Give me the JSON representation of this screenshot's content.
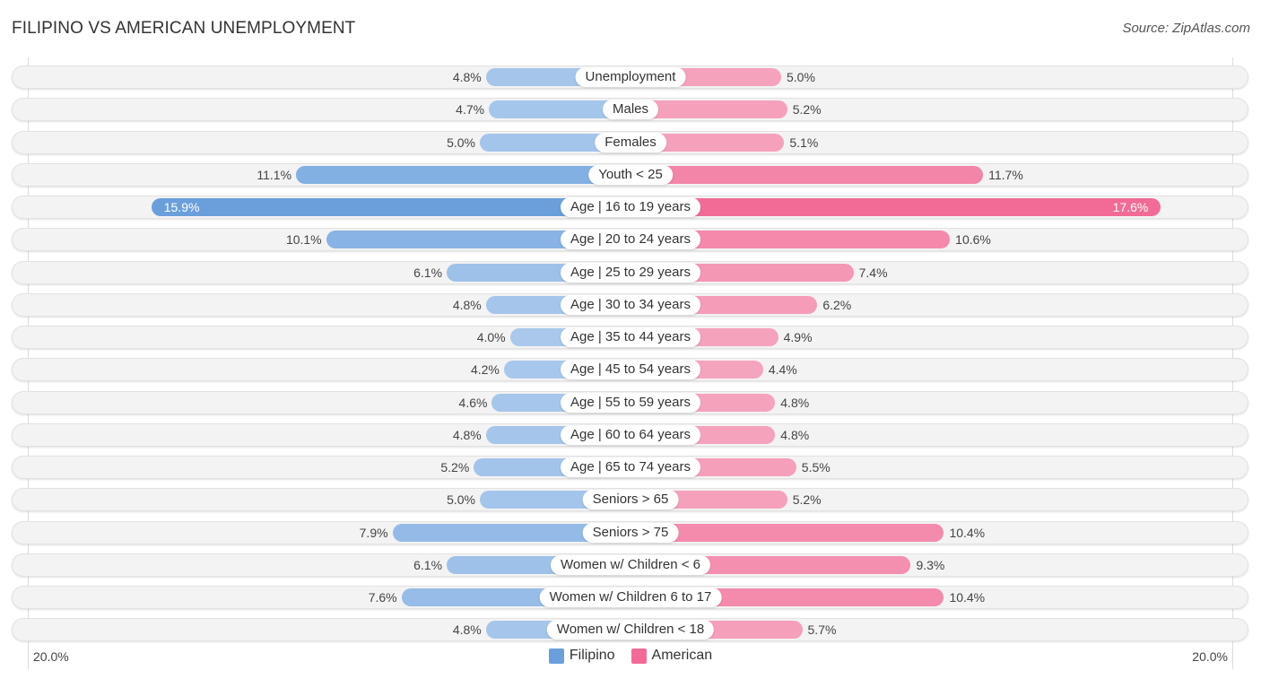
{
  "title": "FILIPINO VS AMERICAN UNEMPLOYMENT",
  "source": "Source: ZipAtlas.com",
  "colors": {
    "filipino": "#6a9fdc",
    "filipino_light": "#a9c8ec",
    "american": "#f26b96",
    "american_light": "#f5a6bf"
  },
  "chart_data": {
    "type": "bar",
    "orientation": "horizontal-diverging",
    "title": "FILIPINO VS AMERICAN UNEMPLOYMENT",
    "categories": [
      "Unemployment",
      "Males",
      "Females",
      "Youth < 25",
      "Age | 16 to 19 years",
      "Age | 20 to 24 years",
      "Age | 25 to 29 years",
      "Age | 30 to 34 years",
      "Age | 35 to 44 years",
      "Age | 45 to 54 years",
      "Age | 55 to 59 years",
      "Age | 60 to 64 years",
      "Age | 65 to 74 years",
      "Seniors > 65",
      "Seniors > 75",
      "Women w/ Children < 6",
      "Women w/ Children 6 to 17",
      "Women w/ Children < 18"
    ],
    "series": [
      {
        "name": "Filipino",
        "side": "left",
        "values": [
          4.8,
          4.7,
          5.0,
          11.1,
          15.9,
          10.1,
          6.1,
          4.8,
          4.0,
          4.2,
          4.6,
          4.8,
          5.2,
          5.0,
          7.9,
          6.1,
          7.6,
          4.8
        ],
        "labels": [
          "4.8%",
          "4.7%",
          "5.0%",
          "11.1%",
          "15.9%",
          "10.1%",
          "6.1%",
          "4.8%",
          "4.0%",
          "4.2%",
          "4.6%",
          "4.8%",
          "5.2%",
          "5.0%",
          "7.9%",
          "6.1%",
          "7.6%",
          "4.8%"
        ]
      },
      {
        "name": "American",
        "side": "right",
        "values": [
          5.0,
          5.2,
          5.1,
          11.7,
          17.6,
          10.6,
          7.4,
          6.2,
          4.9,
          4.4,
          4.8,
          4.8,
          5.5,
          5.2,
          10.4,
          9.3,
          10.4,
          5.7
        ],
        "labels": [
          "5.0%",
          "5.2%",
          "5.1%",
          "11.7%",
          "17.6%",
          "10.6%",
          "7.4%",
          "6.2%",
          "4.9%",
          "4.4%",
          "4.8%",
          "4.8%",
          "5.5%",
          "5.2%",
          "10.4%",
          "9.3%",
          "10.4%",
          "5.7%"
        ]
      }
    ],
    "xlim": [
      -20,
      20
    ],
    "axis_labels": {
      "left": "20.0%",
      "right": "20.0%"
    },
    "legend": {
      "position": "bottom-center",
      "items": [
        "Filipino",
        "American"
      ]
    },
    "unit": "%"
  }
}
